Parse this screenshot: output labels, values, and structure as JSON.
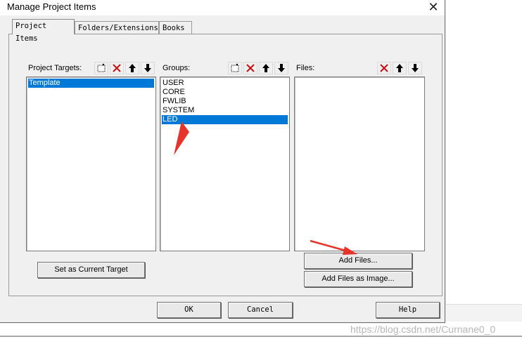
{
  "window": {
    "title": "Manage Project Items"
  },
  "tabs": [
    {
      "label": "Project Items",
      "active": true
    },
    {
      "label": "Folders/Extensions",
      "active": false
    },
    {
      "label": "Books",
      "active": false
    }
  ],
  "project_targets": {
    "label": "Project Targets:",
    "items": [
      "Template"
    ],
    "selected": "Template"
  },
  "groups": {
    "label": "Groups:",
    "items": [
      "USER",
      "CORE",
      "FWLIB",
      "SYSTEM",
      "LED"
    ],
    "selected": "LED"
  },
  "files": {
    "label": "Files:",
    "items": []
  },
  "buttons": {
    "set_current_target": "Set as Current Target",
    "add_files": "Add Files...",
    "add_files_image": "Add Files as Image...",
    "ok": "OK",
    "cancel": "Cancel",
    "help": "Help"
  },
  "watermark": "https://blog.csdn.net/Curnane0_0",
  "colors": {
    "selection": "#0078d7",
    "annotation_arrow": "#e8332b",
    "delete_icon": "#c81010"
  }
}
